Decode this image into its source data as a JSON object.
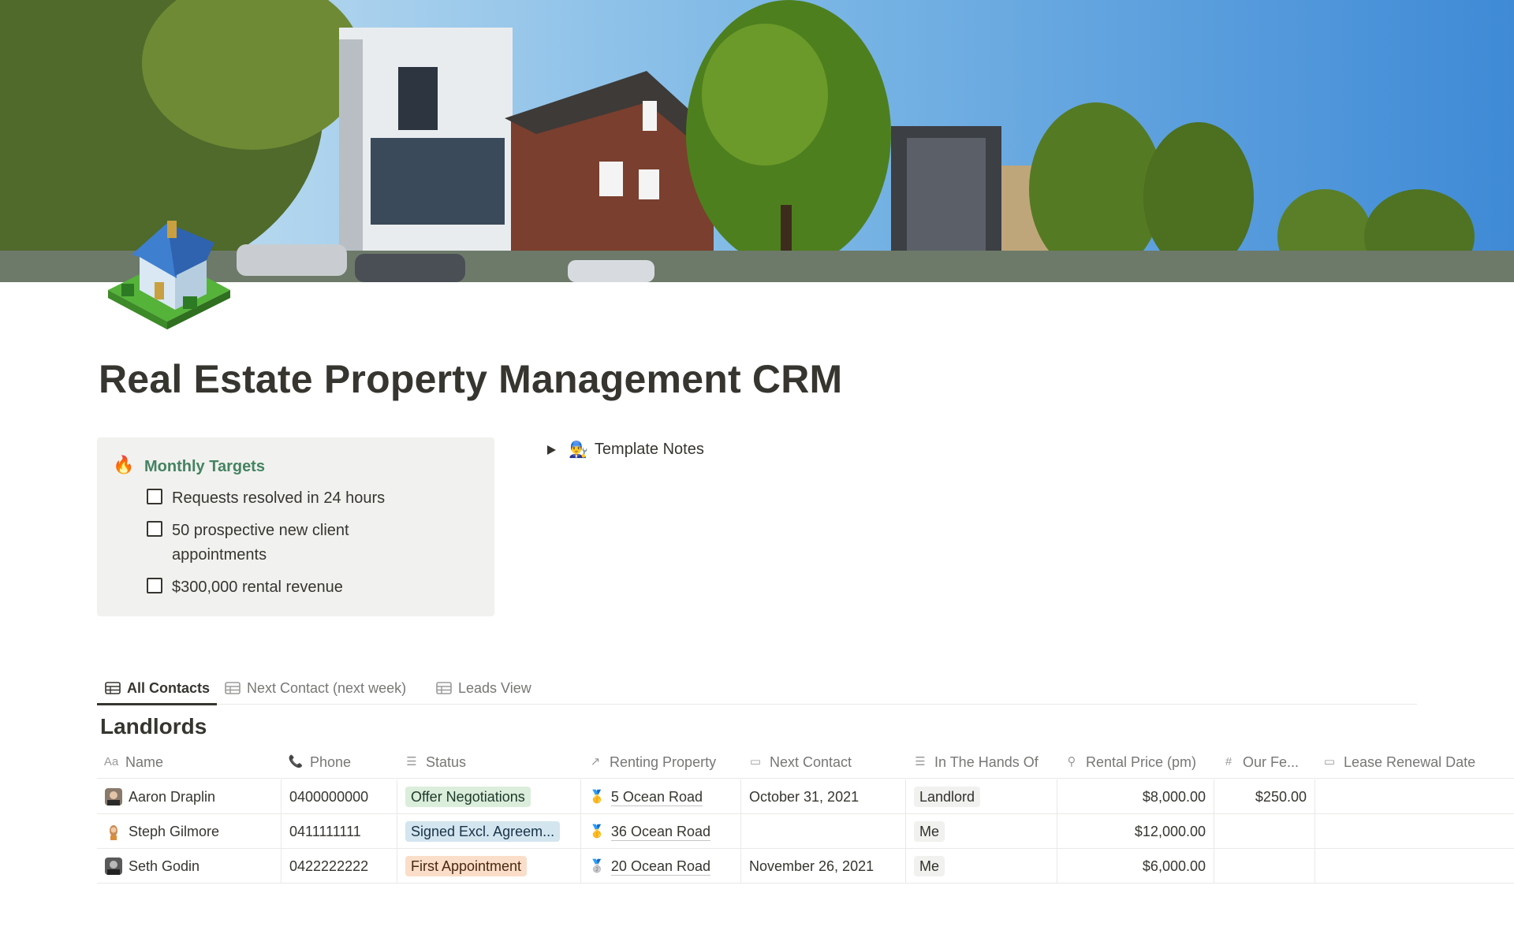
{
  "page": {
    "title": "Real Estate Property Management CRM"
  },
  "callout": {
    "icon": "🔥",
    "title": "Monthly Targets",
    "todos": [
      "Requests resolved in 24 hours",
      "50 prospective new client appointments",
      "$300,000 rental revenue"
    ]
  },
  "toggle": {
    "emoji": "👨‍🔧",
    "label": "Template Notes"
  },
  "tabs": [
    {
      "label": "All Contacts",
      "icon": "table-icon",
      "active": true
    },
    {
      "label": "Next Contact (next week)",
      "icon": "table-icon",
      "active": false
    },
    {
      "label": "Leads View",
      "icon": "table-icon",
      "active": false
    }
  ],
  "group": {
    "title": "Landlords"
  },
  "columns": [
    {
      "label": "Name",
      "icon": "Aa"
    },
    {
      "label": "Phone",
      "icon": "phone-icon"
    },
    {
      "label": "Status",
      "icon": "list-icon"
    },
    {
      "label": "Renting Property",
      "icon": "relation-arrow-icon"
    },
    {
      "label": "Next Contact",
      "icon": "calendar-icon"
    },
    {
      "label": "In The Hands Of",
      "icon": "list-icon"
    },
    {
      "label": "Rental Price (pm)",
      "icon": "search-icon"
    },
    {
      "label": "Our Fe...",
      "icon": "hash-icon"
    },
    {
      "label": "Lease Renewal Date",
      "icon": "calendar-icon"
    }
  ],
  "rows": [
    {
      "name": "Aaron Draplin",
      "phone": "0400000000",
      "status": "Offer Negotiations",
      "status_color": "#dbeddb",
      "property": "5 Ocean Road",
      "property_icon": "🥇",
      "next_contact": "October 31, 2021",
      "hands": "Landlord",
      "price": "$8,000.00",
      "fee": "$250.00",
      "renewal": ""
    },
    {
      "name": "Steph Gilmore",
      "phone": "0411111111",
      "status": "Signed Excl. Agreem...",
      "status_color": "#d3e5ef",
      "property": "36 Ocean Road",
      "property_icon": "🥇",
      "next_contact": "",
      "hands": "Me",
      "price": "$12,000.00",
      "fee": "",
      "renewal": ""
    },
    {
      "name": "Seth Godin",
      "phone": "0422222222",
      "status": "First Appointment",
      "status_color": "#fadec9",
      "property": "20 Ocean Road",
      "property_icon": "🥈",
      "next_contact": "November 26, 2021",
      "hands": "Me",
      "price": "$6,000.00",
      "fee": "",
      "renewal": ""
    }
  ]
}
